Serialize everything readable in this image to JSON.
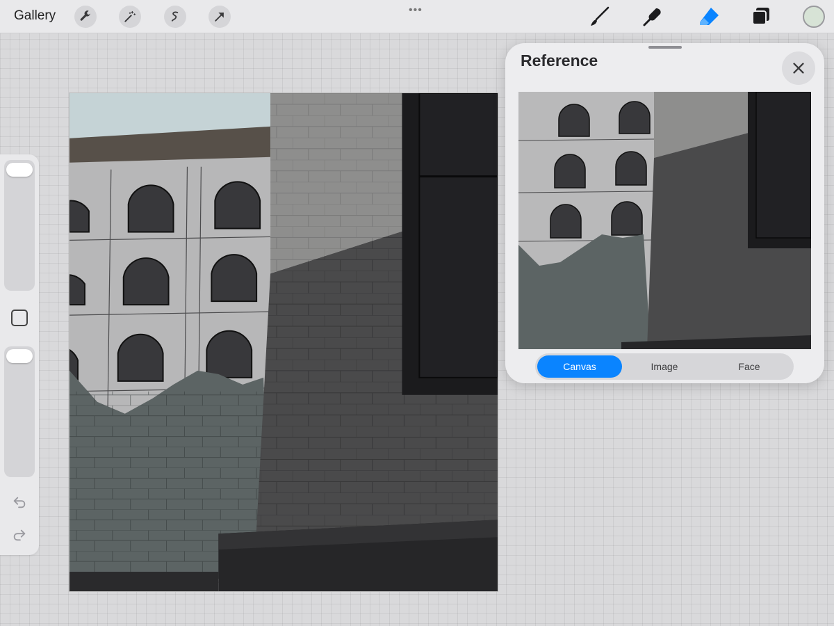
{
  "toolbar": {
    "gallery_label": "Gallery",
    "left_tools": [
      "wrench-icon",
      "magic-wand-icon",
      "selection-icon",
      "transform-arrow-icon"
    ],
    "more_label": "•••",
    "right_tools": [
      "brush-icon",
      "smudge-icon",
      "eraser-icon",
      "layers-icon"
    ],
    "active_tool": "eraser-icon",
    "current_color": "#d7e3d6",
    "accent_color": "#0a84ff"
  },
  "sidebar": {
    "brush_size_slider": 0.0,
    "opacity_slider": 0.0
  },
  "reference": {
    "title": "Reference",
    "tabs": [
      {
        "label": "Canvas",
        "active": true
      },
      {
        "label": "Image",
        "active": false
      },
      {
        "label": "Face",
        "active": false
      }
    ]
  }
}
